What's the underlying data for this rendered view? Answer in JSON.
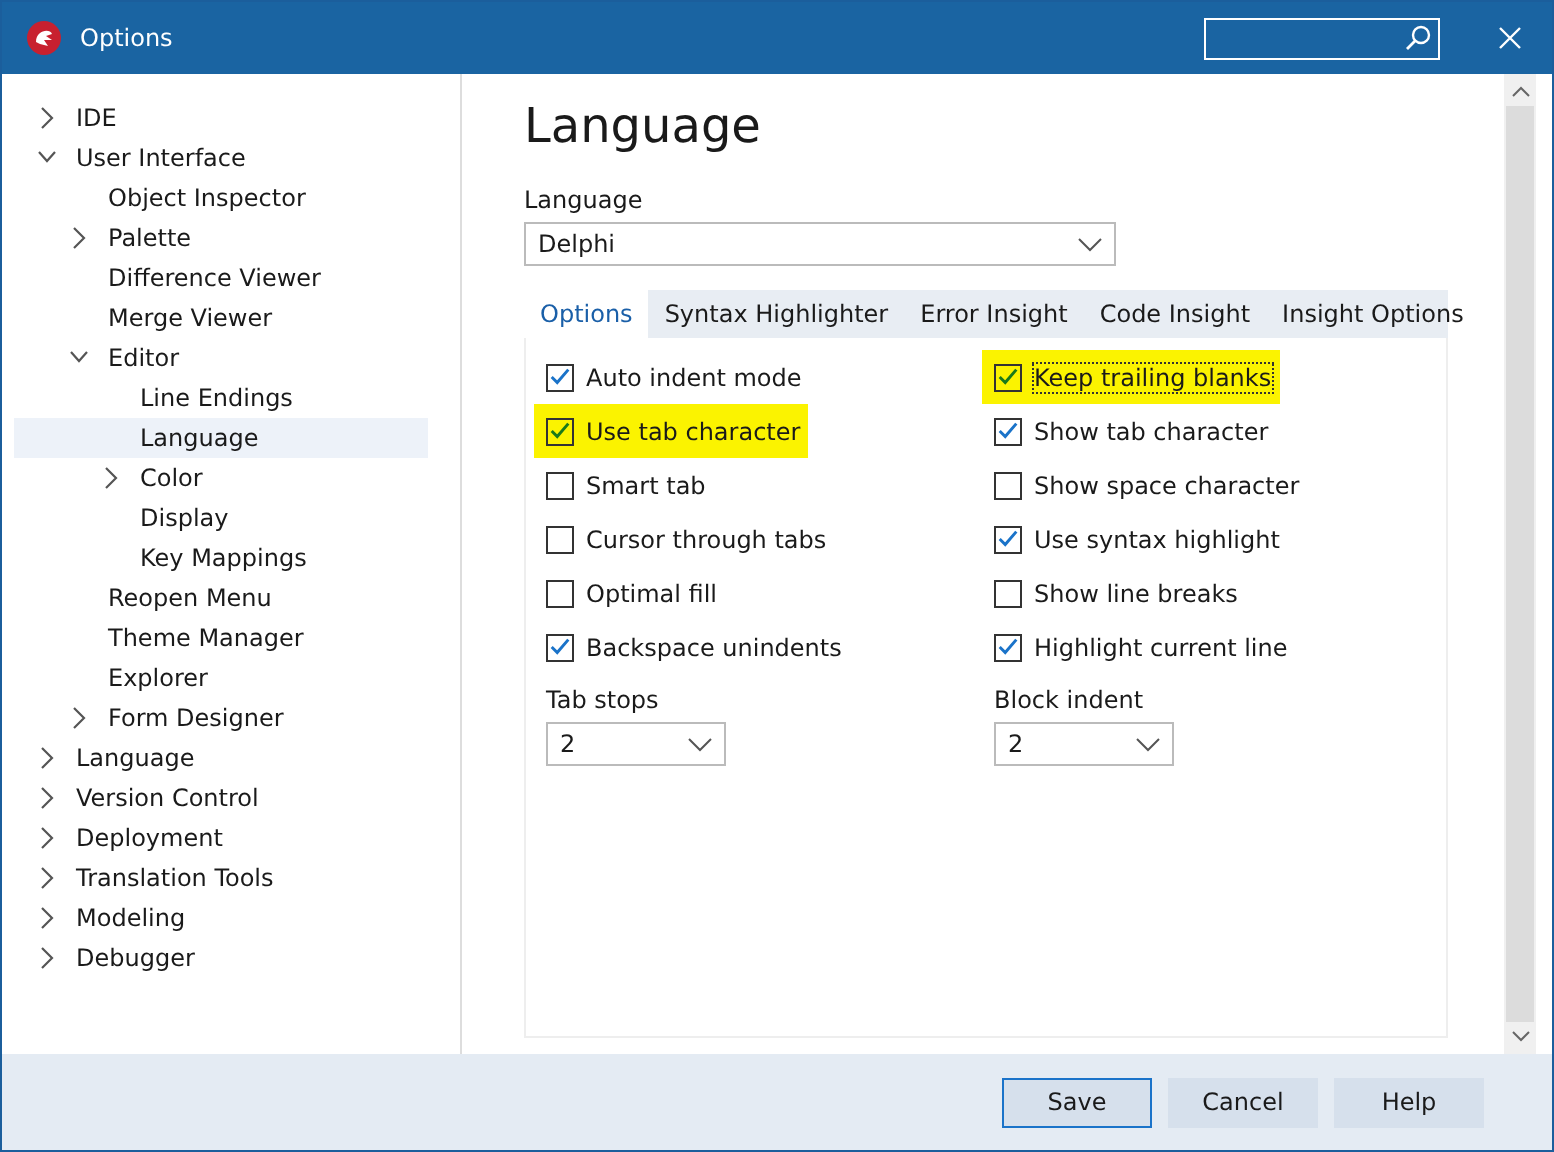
{
  "window": {
    "title": "Options"
  },
  "tree": [
    {
      "label": "IDE",
      "expanded": false,
      "selected": false
    },
    {
      "label": "User Interface",
      "expanded": true,
      "selected": false,
      "children": [
        {
          "label": "Object Inspector",
          "selected": false
        },
        {
          "label": "Palette",
          "expanded": false,
          "selected": false
        },
        {
          "label": "Difference Viewer",
          "selected": false
        },
        {
          "label": "Merge Viewer",
          "selected": false
        },
        {
          "label": "Editor",
          "expanded": true,
          "selected": false,
          "children": [
            {
              "label": "Line Endings",
              "selected": false
            },
            {
              "label": "Language",
              "selected": true
            },
            {
              "label": "Color",
              "expanded": false,
              "selected": false
            },
            {
              "label": "Display",
              "selected": false
            },
            {
              "label": "Key Mappings",
              "selected": false
            }
          ]
        },
        {
          "label": "Reopen Menu",
          "selected": false
        },
        {
          "label": "Theme Manager",
          "selected": false
        },
        {
          "label": "Explorer",
          "selected": false
        },
        {
          "label": "Form Designer",
          "expanded": false,
          "selected": false
        }
      ]
    },
    {
      "label": "Language",
      "expanded": false,
      "selected": false
    },
    {
      "label": "Version Control",
      "expanded": false,
      "selected": false
    },
    {
      "label": "Deployment",
      "expanded": false,
      "selected": false
    },
    {
      "label": "Translation Tools",
      "expanded": false,
      "selected": false
    },
    {
      "label": "Modeling",
      "expanded": false,
      "selected": false
    },
    {
      "label": "Debugger",
      "expanded": false,
      "selected": false
    }
  ],
  "page": {
    "heading": "Language",
    "language_label": "Language",
    "language_value": "Delphi",
    "tabs": [
      {
        "label": "Options",
        "selected": true
      },
      {
        "label": "Syntax Highlighter",
        "selected": false
      },
      {
        "label": "Error Insight",
        "selected": false
      },
      {
        "label": "Code Insight",
        "selected": false
      },
      {
        "label": "Insight Options",
        "selected": false
      }
    ],
    "left_options": [
      {
        "label": "Auto indent mode",
        "checked": true,
        "highlighted": false
      },
      {
        "label": "Use tab character",
        "checked": true,
        "highlighted": true
      },
      {
        "label": "Smart tab",
        "checked": false,
        "highlighted": false
      },
      {
        "label": "Cursor through tabs",
        "checked": false,
        "highlighted": false
      },
      {
        "label": "Optimal fill",
        "checked": false,
        "highlighted": false
      },
      {
        "label": "Backspace unindents",
        "checked": true,
        "highlighted": false
      }
    ],
    "right_options": [
      {
        "label": "Keep trailing blanks",
        "checked": true,
        "highlighted": true
      },
      {
        "label": "Show tab character",
        "checked": true,
        "highlighted": false
      },
      {
        "label": "Show space character",
        "checked": false,
        "highlighted": false
      },
      {
        "label": "Use syntax highlight",
        "checked": true,
        "highlighted": false
      },
      {
        "label": "Show line breaks",
        "checked": false,
        "highlighted": false
      },
      {
        "label": "Highlight current line",
        "checked": true,
        "highlighted": false
      }
    ],
    "tab_stops_label": "Tab stops",
    "tab_stops_value": "2",
    "block_indent_label": "Block indent",
    "block_indent_value": "2"
  },
  "buttons": [
    {
      "label": "Save",
      "default": true
    },
    {
      "label": "Cancel",
      "default": false
    },
    {
      "label": "Help",
      "default": false
    }
  ]
}
